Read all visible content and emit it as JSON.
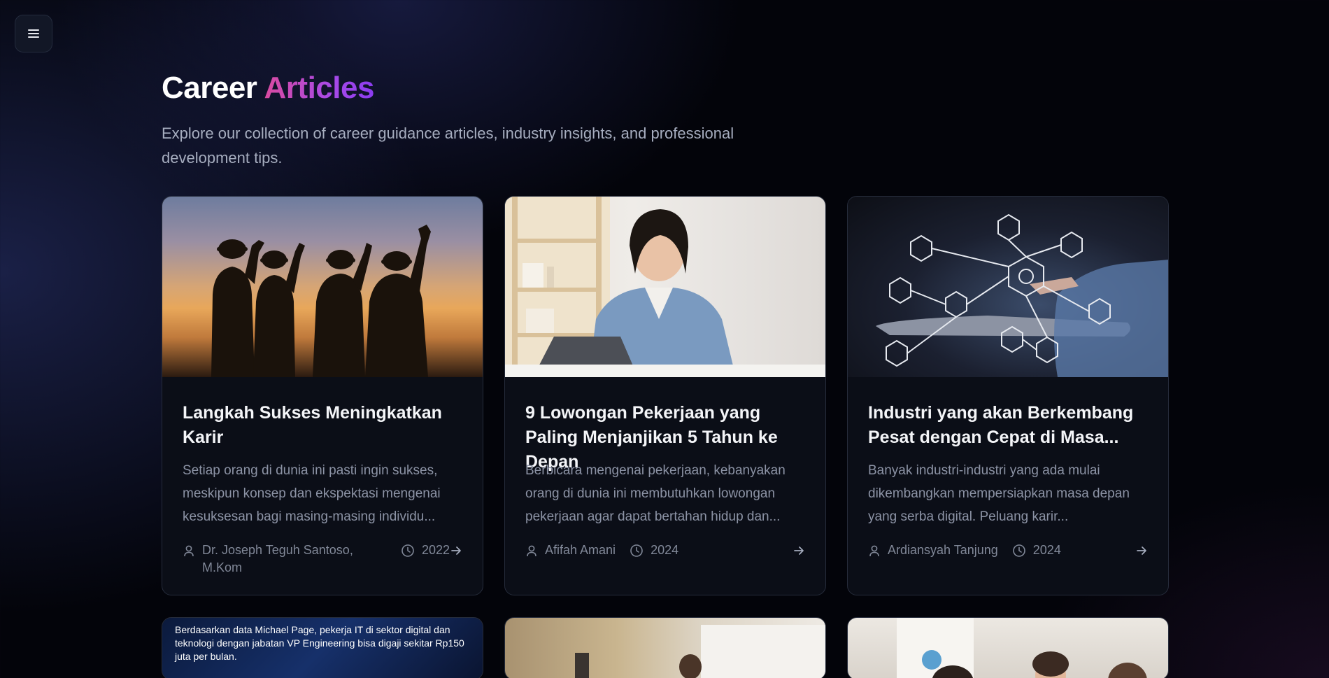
{
  "header": {
    "title_main": "Career",
    "title_accent": "Articles",
    "subtitle": "Explore our collection of career guidance articles, industry insights, and professional development tips."
  },
  "menu": {
    "icon": "hamburger-menu-icon"
  },
  "articles": [
    {
      "title": "Langkah Sukses Meningkatkan Karir",
      "excerpt": "Setiap orang di dunia ini pasti ingin sukses, meskipun konsep dan ekspektasi mengenai kesuksesan bagi masing-masing individu...",
      "author": "Dr. Joseph Teguh Santoso, M.Kom",
      "year": "2022"
    },
    {
      "title": "9 Lowongan Pekerjaan yang Paling Menjanjikan 5 Tahun ke Depan",
      "excerpt": "Berbicara mengenai pekerjaan, kebanyakan orang di dunia ini membutuhkan lowongan pekerjaan agar dapat bertahan hidup dan...",
      "author": "Afifah Amani",
      "year": "2024"
    },
    {
      "title": "Industri yang akan Berkembang Pesat dengan Cepat di Masa...",
      "excerpt": "Banyak industri-industri yang ada mulai dikembangkan mempersiapkan masa depan yang serba digital. Peluang karir...",
      "author": "Ardiansyah Tanjung",
      "year": "2024"
    }
  ],
  "partial_cards": [
    {
      "image_caption": "Berdasarkan data Michael Page, pekerja IT di sektor digital dan teknologi dengan jabatan VP Engineering bisa digaji sekitar Rp150 juta per bulan."
    },
    {
      "image_caption": ""
    },
    {
      "image_caption": ""
    }
  ],
  "colors": {
    "accent_start": "#d94aa0",
    "accent_end": "#8b3cf0",
    "card_bg": "#0b0e17",
    "muted_text": "#8c93a5"
  }
}
